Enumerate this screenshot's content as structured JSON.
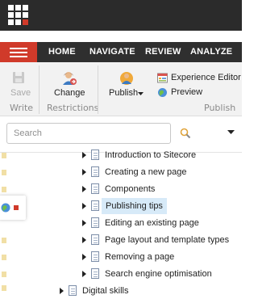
{
  "tabs": [
    "HOME",
    "NAVIGATE",
    "REVIEW",
    "ANALYZE"
  ],
  "ribbon": {
    "save": "Save",
    "write_section": "Write",
    "change": "Change",
    "restrictions_section": "Restrictions",
    "publish": "Publish",
    "experience_editor": "Experience Editor",
    "preview": "Preview",
    "publish_section": "Publish"
  },
  "search": {
    "placeholder": "Search",
    "value": ""
  },
  "tree": {
    "items": [
      {
        "label": "Introduction to Sitecore",
        "selected": false
      },
      {
        "label": "Creating a new page",
        "selected": false
      },
      {
        "label": "Components",
        "selected": false
      },
      {
        "label": "Publishing tips",
        "selected": true
      },
      {
        "label": "Editing an existing page",
        "selected": false
      },
      {
        "label": "Page layout and template types",
        "selected": false
      },
      {
        "label": "Removing a page",
        "selected": false
      },
      {
        "label": "Search engine optimisation",
        "selected": false
      }
    ],
    "partial_item": "Digital skills"
  },
  "colors": {
    "accent": "#d03a2a",
    "topbar": "#2b2b2b",
    "tabbar": "#2f2f2f",
    "ribbon_bg": "#f2f2f2",
    "selection": "#d7eaf8"
  }
}
